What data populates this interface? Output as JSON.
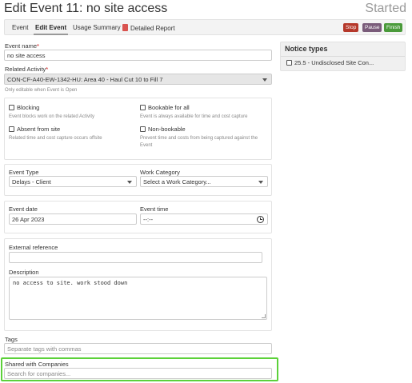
{
  "header": {
    "title": "Edit Event 11: no site access",
    "status": "Started"
  },
  "toolbar": {
    "tabs": [
      "Event",
      "Edit Event",
      "Usage Summary",
      "Detailed Report"
    ],
    "active_tab": "Edit Event",
    "buttons": [
      {
        "label": "Stop",
        "color": "#b5382a"
      },
      {
        "label": "Pause",
        "color": "#7a5c7a"
      },
      {
        "label": "Finish",
        "color": "#4a9a3a"
      }
    ]
  },
  "form": {
    "event_name": {
      "label": "Event name",
      "required_mark": "*",
      "value": "no site access"
    },
    "related_activity": {
      "label": "Related Activity",
      "required_mark": "*",
      "value": "CON-CF-A40-EW-1342-HU: Area 40 - Haul Cut 10 to Fill 7",
      "hint": "Only editable when Event is Open"
    },
    "flags": {
      "blocking": {
        "label": "Blocking",
        "hint": "Event blocks work on the related Activity",
        "checked": false
      },
      "bookable": {
        "label": "Bookable for all",
        "hint": "Event is always available for time and cost capture",
        "checked": false
      },
      "absent": {
        "label": "Absent from site",
        "hint": "Related time and cost capture occurs offsite",
        "checked": false
      },
      "non_bookable": {
        "label": "Non-bookable",
        "hint_line1": "Prevent time and costs from being captured against the",
        "hint_line2": "Event",
        "checked": false
      }
    },
    "event_type": {
      "label": "Event Type",
      "value": "Delays - Client"
    },
    "work_category": {
      "label": "Work Category",
      "value": "Select a Work Category..."
    },
    "event_date": {
      "label": "Event date",
      "value": "26 Apr 2023"
    },
    "event_time": {
      "label": "Event time",
      "value": "--:--"
    },
    "external_reference": {
      "label": "External reference",
      "value": ""
    },
    "description": {
      "label": "Description",
      "value": "no access to site. work stood down"
    },
    "tags": {
      "label": "Tags",
      "placeholder": "Separate tags with commas"
    },
    "shared_with": {
      "label": "Shared with Companies",
      "placeholder": "Search for companies..."
    }
  },
  "notice_types": {
    "title": "Notice types",
    "items": [
      {
        "label": "25.5 - Undisclosed Site Con...",
        "checked": false
      }
    ]
  },
  "colors": {
    "highlight": "#5cd13a",
    "accent_bar": "#f3f3f3"
  }
}
